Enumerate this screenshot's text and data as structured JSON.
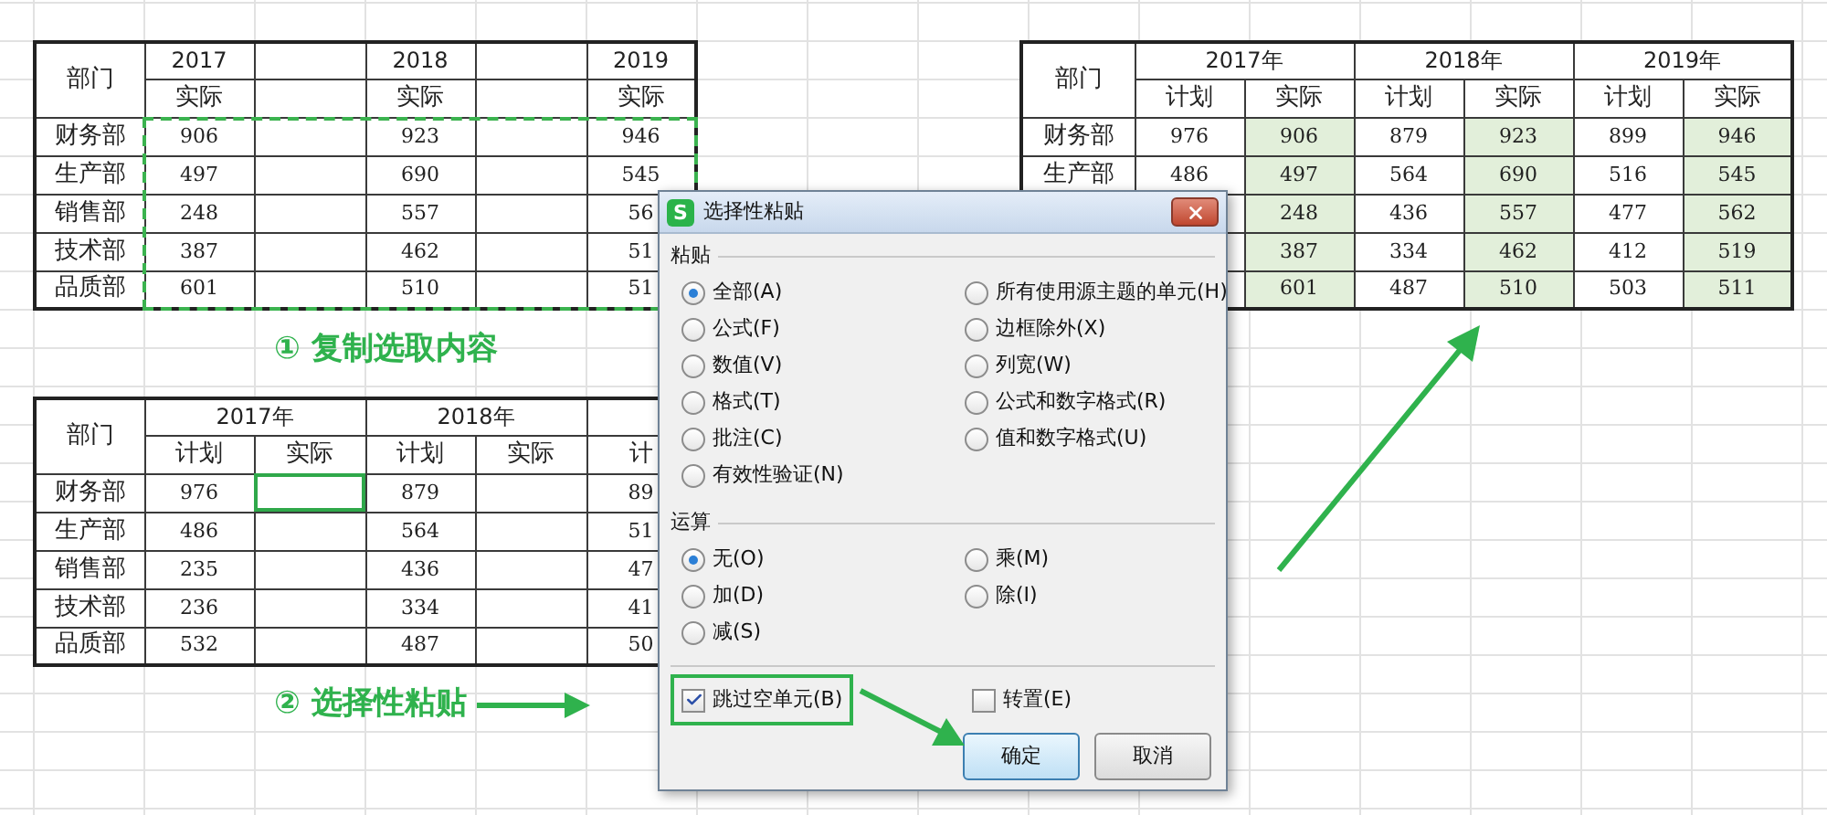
{
  "sheet": {
    "tables": [
      {
        "copied": true,
        "header": {
          "corner": "部门",
          "groups": [
            {
              "label": "2017",
              "subheaders": [
                {
                  "kind": "label",
                  "text": "实际"
                },
                {
                  "kind": "blank"
                }
              ]
            },
            {
              "label": "2018",
              "subheaders": [
                {
                  "kind": "label",
                  "text": "实际"
                },
                {
                  "kind": "blank"
                }
              ]
            },
            {
              "label": "2019",
              "subheaders": [
                {
                  "kind": "label",
                  "text": "实际"
                }
              ]
            }
          ]
        },
        "rows": [
          {
            "department": "财务部",
            "cells": [
              {
                "text": "906"
              },
              {},
              {
                "text": "923"
              },
              {},
              {
                "text": "946"
              }
            ]
          },
          {
            "department": "生产部",
            "cells": [
              {
                "text": "497"
              },
              {},
              {
                "text": "690"
              },
              {},
              {
                "text": "545"
              }
            ]
          },
          {
            "department": "销售部",
            "cells": [
              {
                "text": "248"
              },
              {},
              {
                "text": "557"
              },
              {},
              {
                "text": "56"
              }
            ]
          },
          {
            "department": "技术部",
            "cells": [
              {
                "text": "387"
              },
              {},
              {
                "text": "462"
              },
              {},
              {
                "text": "51"
              }
            ]
          },
          {
            "department": "品质部",
            "cells": [
              {
                "text": "601"
              },
              {},
              {
                "text": "510"
              },
              {},
              {
                "text": "51"
              }
            ]
          }
        ]
      },
      {
        "header": {
          "corner": "部门",
          "groups": [
            {
              "label": "2017年",
              "merged": true,
              "subheaders": [
                {
                  "text": "计划"
                },
                {
                  "text": "实际"
                }
              ]
            },
            {
              "label": "2018年",
              "merged": true,
              "subheaders": [
                {
                  "text": "计划"
                },
                {
                  "text": "实际"
                }
              ]
            },
            {
              "subheaders": [
                {
                  "text": "计"
                }
              ]
            }
          ]
        },
        "rows": [
          {
            "department": "财务部",
            "cells": [
              {
                "text": "976",
                "selected": false
              },
              {
                "selected": true
              },
              {
                "text": "879",
                "selected": false
              },
              {
                "selected": false
              },
              {
                "text": "89",
                "selected": false
              }
            ]
          },
          {
            "department": "生产部",
            "cells": [
              {
                "text": "486",
                "selected": false
              },
              {
                "selected": false
              },
              {
                "text": "564",
                "selected": false
              },
              {
                "selected": false
              },
              {
                "text": "51",
                "selected": false
              }
            ]
          },
          {
            "department": "销售部",
            "cells": [
              {
                "text": "235",
                "selected": false
              },
              {
                "selected": false
              },
              {
                "text": "436",
                "selected": false
              },
              {
                "selected": false
              },
              {
                "text": "47",
                "selected": false
              }
            ]
          },
          {
            "department": "技术部",
            "cells": [
              {
                "text": "236",
                "selected": false
              },
              {
                "selected": false
              },
              {
                "text": "334",
                "selected": false
              },
              {
                "selected": false
              },
              {
                "text": "41",
                "selected": false
              }
            ]
          },
          {
            "department": "品质部",
            "cells": [
              {
                "text": "532",
                "selected": false
              },
              {
                "selected": false
              },
              {
                "text": "487",
                "selected": false
              },
              {
                "selected": false
              },
              {
                "text": "50",
                "selected": false
              }
            ]
          }
        ]
      },
      {
        "header": {
          "corner": "部门",
          "groups": [
            {
              "label": "2017年",
              "merged": true,
              "subheaders": [
                {
                  "text": "计划"
                },
                {
                  "text": "实际"
                }
              ]
            },
            {
              "label": "2018年",
              "merged": true,
              "subheaders": [
                {
                  "text": "计划"
                },
                {
                  "text": "实际"
                }
              ]
            },
            {
              "label": "2019年",
              "merged": true,
              "subheaders": [
                {
                  "text": "计划"
                },
                {
                  "text": "实际"
                }
              ]
            }
          ]
        },
        "rows": [
          {
            "department": "财务部",
            "cells": [
              {
                "text": "976",
                "shaded": false
              },
              {
                "text": "906",
                "shaded": true
              },
              {
                "text": "879",
                "shaded": false
              },
              {
                "text": "923",
                "shaded": true
              },
              {
                "text": "899",
                "shaded": false
              },
              {
                "text": "946",
                "shaded": true
              }
            ]
          },
          {
            "department": "生产部",
            "cells": [
              {
                "text": "486",
                "shaded": false
              },
              {
                "text": "497",
                "shaded": true
              },
              {
                "text": "564",
                "shaded": false
              },
              {
                "text": "690",
                "shaded": true
              },
              {
                "text": "516",
                "shaded": false
              },
              {
                "text": "545",
                "shaded": true
              }
            ]
          },
          {
            "cells": [
              {
                "shaded": false
              },
              {
                "text": "248",
                "shaded": true
              },
              {
                "text": "436",
                "shaded": false
              },
              {
                "text": "557",
                "shaded": true
              },
              {
                "text": "477",
                "shaded": false
              },
              {
                "text": "562",
                "shaded": true
              }
            ]
          },
          {
            "cells": [
              {
                "shaded": false
              },
              {
                "text": "387",
                "shaded": true
              },
              {
                "text": "334",
                "shaded": false
              },
              {
                "text": "462",
                "shaded": true
              },
              {
                "text": "412",
                "shaded": false
              },
              {
                "text": "519",
                "shaded": true
              }
            ]
          },
          {
            "cells": [
              {
                "shaded": false
              },
              {
                "text": "601",
                "shaded": true
              },
              {
                "text": "487",
                "shaded": false
              },
              {
                "text": "510",
                "shaded": true
              },
              {
                "text": "503",
                "shaded": false
              },
              {
                "text": "511",
                "shaded": true
              }
            ]
          }
        ]
      }
    ],
    "captions": [
      "① 复制选取内容",
      "② 选择性粘贴"
    ]
  },
  "dialog": {
    "icon_letter": "S",
    "title": "选择性粘贴",
    "sections": [
      {
        "label": "粘贴",
        "options": [
          {
            "label": "全部(A)",
            "selected": true
          },
          {
            "label": "所有使用源主题的单元(H)",
            "selected": false
          },
          {
            "label": "公式(F)",
            "selected": false
          },
          {
            "label": "边框除外(X)",
            "selected": false
          },
          {
            "label": "数值(V)",
            "selected": false
          },
          {
            "label": "列宽(W)",
            "selected": false
          },
          {
            "label": "格式(T)",
            "selected": false
          },
          {
            "label": "公式和数字格式(R)",
            "selected": false
          },
          {
            "label": "批注(C)",
            "selected": false
          },
          {
            "label": "值和数字格式(U)",
            "selected": false
          },
          {
            "label": "有效性验证(N)",
            "selected": false
          }
        ]
      },
      {
        "label": "运算",
        "options": [
          {
            "label": "无(O)",
            "selected": true
          },
          {
            "label": "乘(M)",
            "selected": false
          },
          {
            "label": "加(D)",
            "selected": false
          },
          {
            "label": "除(I)",
            "selected": false
          },
          {
            "label": "减(S)",
            "selected": false
          }
        ]
      }
    ],
    "checkboxes": [
      {
        "label": "跳过空单元(B)",
        "checked": true,
        "highlighted": true
      },
      {
        "label": "转置(E)",
        "checked": false,
        "highlighted": false
      }
    ],
    "buttons": [
      {
        "label": "确定",
        "default": true
      },
      {
        "label": "取消",
        "default": false
      }
    ]
  }
}
